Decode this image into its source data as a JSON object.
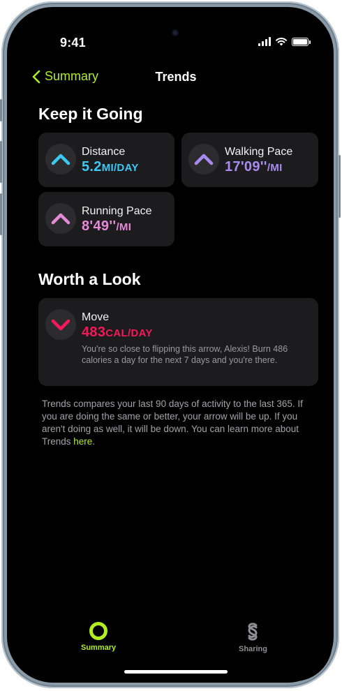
{
  "status_bar": {
    "time": "9:41"
  },
  "nav": {
    "back_label": "Summary",
    "title": "Trends"
  },
  "sections": {
    "keep_going": "Keep it Going",
    "worth_look": "Worth a Look"
  },
  "trends": {
    "distance": {
      "label": "Distance",
      "value": "5.2",
      "unit": "MI/DAY",
      "color": "#3ec7f3",
      "direction": "up"
    },
    "walking": {
      "label": "Walking Pace",
      "value": "17'09''",
      "unit": "/MI",
      "color": "#a98bf0",
      "direction": "up"
    },
    "running": {
      "label": "Running Pace",
      "value": "8'49''",
      "unit": "/MI",
      "color": "#e48ad8",
      "direction": "up"
    },
    "move": {
      "label": "Move",
      "value": "483",
      "unit": "CAL/DAY",
      "color": "#f3195a",
      "direction": "down",
      "description": "You're so close to flipping this arrow, Alexis! Burn 486 calories a day for the next 7 days and you're there."
    }
  },
  "footnote": {
    "text": "Trends compares your last 90 days of activity to the last 365. If you are doing the same or better, your arrow will be up. If you aren't doing as well, it will be down. You can learn more about Trends ",
    "link": "here",
    "end": "."
  },
  "tabs": [
    {
      "label": "Summary",
      "icon": "summary-ring-icon",
      "active": true
    },
    {
      "label": "Sharing",
      "icon": "sharing-icon",
      "active": false
    }
  ],
  "colors": {
    "accent": "#b1ed22",
    "inactive_tab": "#8e8e93"
  }
}
